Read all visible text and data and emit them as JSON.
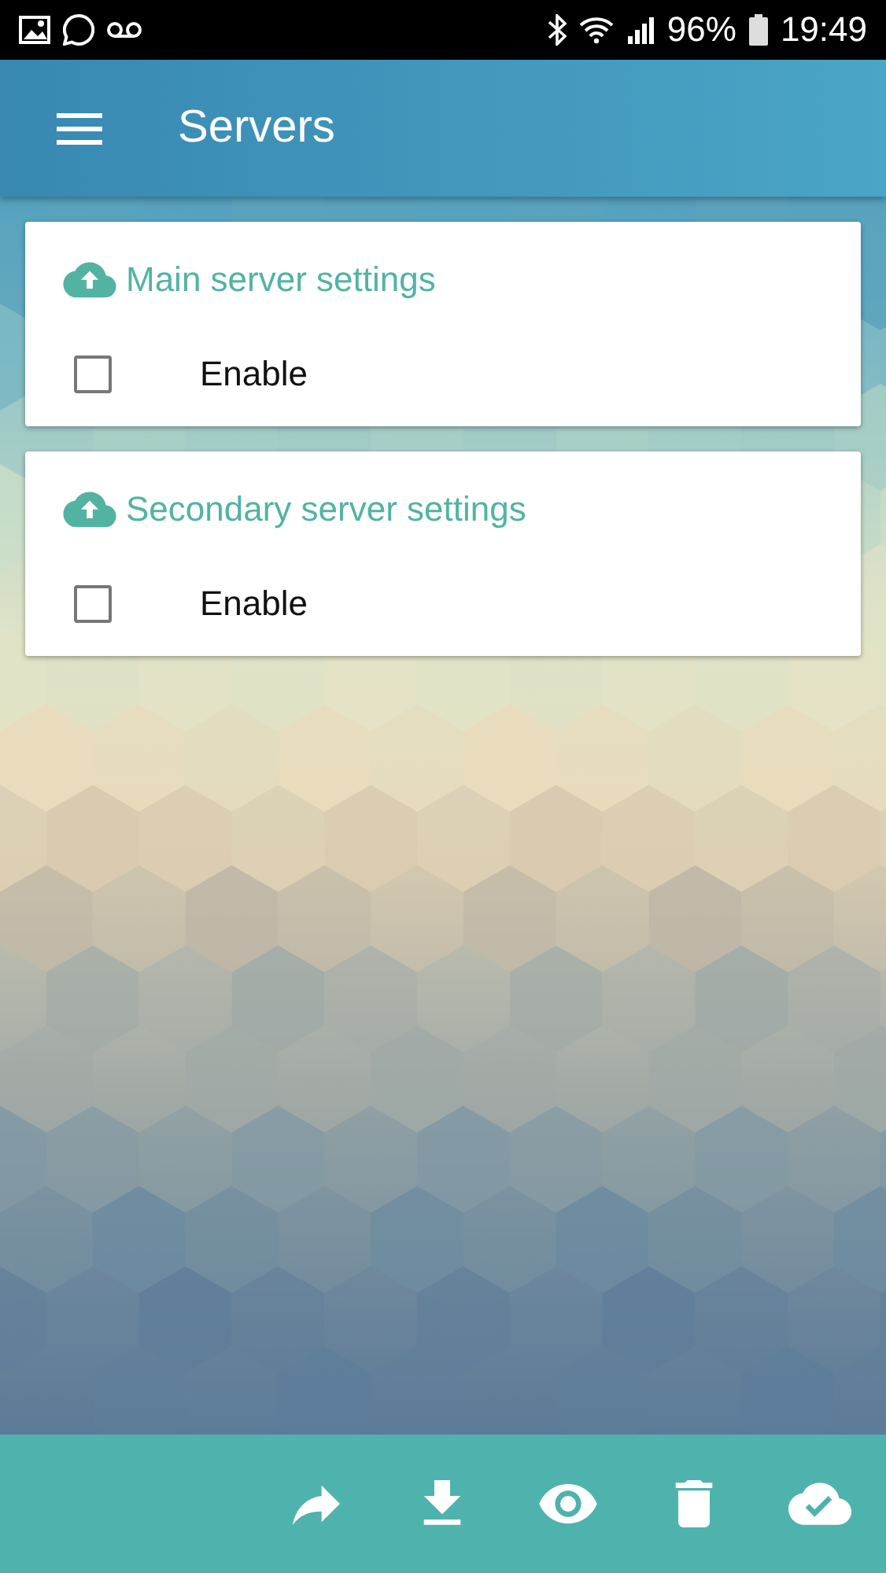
{
  "status_bar": {
    "battery": "96%",
    "time": "19:49"
  },
  "app_bar": {
    "title": "Servers"
  },
  "cards": [
    {
      "title": "Main server settings",
      "option": {
        "label": "Enable",
        "checked": false
      }
    },
    {
      "title": "Secondary server settings",
      "option": {
        "label": "Enable",
        "checked": false
      }
    }
  ]
}
